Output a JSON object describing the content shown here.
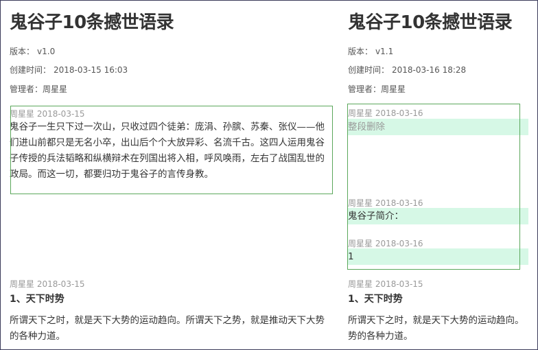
{
  "left": {
    "title": "鬼谷子10条撼世语录",
    "version_label": "版本：",
    "version": "v1.0",
    "created_label": "创建时间：",
    "created": "2018-03-15 16:03",
    "manager_label": "管理者：",
    "manager": "周星星",
    "blocks": [
      {
        "stamp": "周星星 2018-03-15",
        "text": "鬼谷子一生只下过一次山，只收过四个徒弟：庞涓、孙膑、苏秦、张仪——他们进山前都只是无名小卒，出山后个个大放异彩、名流千古。这四人运用鬼谷子传授的兵法韬略和纵横辩术在列国出将入相，呼风唤雨，左右了战国乱世的政局。而这一切，都要归功于鬼谷子的言传身教。"
      },
      {
        "stamp": "周星星 2018-03-15",
        "heading": "1、天下时势",
        "text": "所谓天下之时，就是天下大势的运动趋向。所谓天下之势，就是推动天下大势的各种力道。"
      }
    ]
  },
  "right": {
    "title": "鬼谷子10条撼世语录",
    "version_label": "版本：",
    "version": "v1.1",
    "created_label": "创建时间：",
    "created": "2018-03-16 18:28",
    "manager_label": "管理者：",
    "manager": "周星星",
    "blocks": [
      {
        "stamp": "周星星 2018-03-16",
        "text": "整段删除"
      },
      {
        "stamp": "周星星 2018-03-16",
        "text": "鬼谷子简介："
      },
      {
        "stamp": "周星星 2018-03-16",
        "text": "1"
      },
      {
        "stamp": "周星星 2018-03-15",
        "heading": "1、天下时势",
        "text": "所谓天下之时，就是天下大势的运动趋向。势的各种力道。"
      }
    ]
  },
  "colors": {
    "added_highlight": "#d6f8e6",
    "diff_border": "#5aa75a",
    "timestamp": "#999999"
  }
}
